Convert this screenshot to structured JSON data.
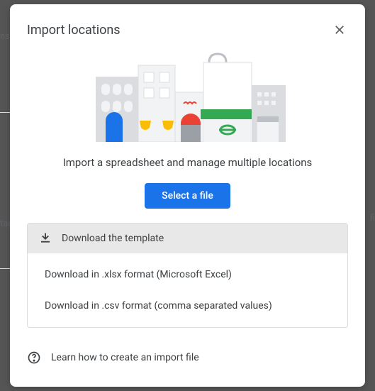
{
  "modal": {
    "title": "Import locations",
    "subtitle": "Import a spreadsheet and manage multiple locations",
    "selectFileLabel": "Select a file",
    "templateHeader": "Download the template",
    "templateOptions": {
      "xlsx": "Download in .xlsx format (Microsoft Excel)",
      "csv": "Download in .csv format (comma separated values)"
    },
    "learnLink": "Learn how to create an import file"
  },
  "icons": {
    "close": "close-icon",
    "download": "download-icon",
    "help": "help-circle-icon"
  },
  "background": {
    "leftText1": "ns",
    "leftText2": "tag",
    "rightText1": "fi"
  },
  "colors": {
    "primary": "#1a73e8",
    "text": "#3c4043",
    "border": "#dadce0"
  }
}
